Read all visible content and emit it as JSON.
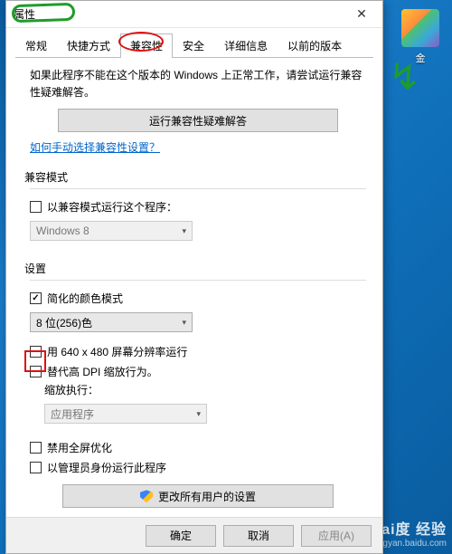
{
  "desktop": {
    "icon_label": "金"
  },
  "watermark": {
    "big": "Bai度 经验",
    "small": "jingyan.baidu.com"
  },
  "dialog": {
    "title_suffix": "属性",
    "close": "✕",
    "tabs": [
      "常规",
      "快捷方式",
      "兼容性",
      "安全",
      "详细信息",
      "以前的版本"
    ],
    "active_tab_index": 2,
    "hint": "如果此程序不能在这个版本的 Windows 上正常工作，请尝试运行兼容性疑难解答。",
    "troubleshoot": "运行兼容性疑难解答",
    "help_link": "如何手动选择兼容性设置？",
    "compat_mode": {
      "group": "兼容模式",
      "checkbox": "以兼容模式运行这个程序：",
      "select_value": "Windows 8"
    },
    "settings": {
      "group": "设置",
      "reduced_color": "简化的颜色模式",
      "color_select": "8 位(256)色",
      "run640": "用 640 x 480 屏幕分辨率运行",
      "override_dpi": "替代高 DPI 缩放行为。",
      "scaling_label": "缩放执行：",
      "scaling_select": "应用程序",
      "disable_fullscreen": "禁用全屏优化",
      "run_as_admin": "以管理员身份运行此程序"
    },
    "all_users_btn": "更改所有用户的设置",
    "buttons": {
      "ok": "确定",
      "cancel": "取消",
      "apply": "应用(A)"
    }
  }
}
